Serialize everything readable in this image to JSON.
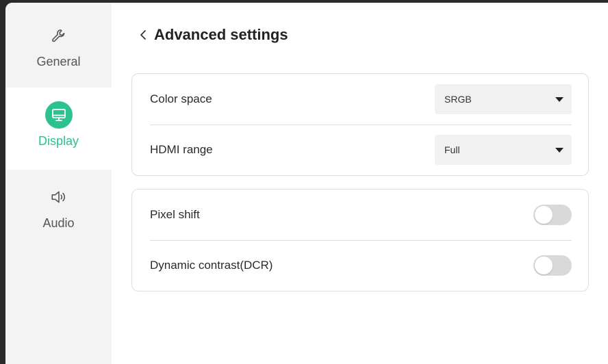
{
  "sidebar": {
    "items": [
      {
        "label": "General",
        "icon": "wrench-icon",
        "active": false
      },
      {
        "label": "Display",
        "icon": "monitor-icon",
        "active": true
      },
      {
        "label": "Audio",
        "icon": "speaker-icon",
        "active": false
      }
    ]
  },
  "header": {
    "title": "Advanced settings",
    "back_icon": "chevron-left-icon"
  },
  "card1": {
    "rows": [
      {
        "label": "Color space",
        "value": "SRGB"
      },
      {
        "label": "HDMI range",
        "value": "Full"
      }
    ]
  },
  "card2": {
    "rows": [
      {
        "label": "Pixel shift",
        "on": false
      },
      {
        "label": "Dynamic contrast(DCR)",
        "on": false
      }
    ]
  },
  "colors": {
    "accent": "#2bc28e",
    "toggle_off": "#d9d9d9",
    "sidebar_bg": "#f3f3f3"
  }
}
